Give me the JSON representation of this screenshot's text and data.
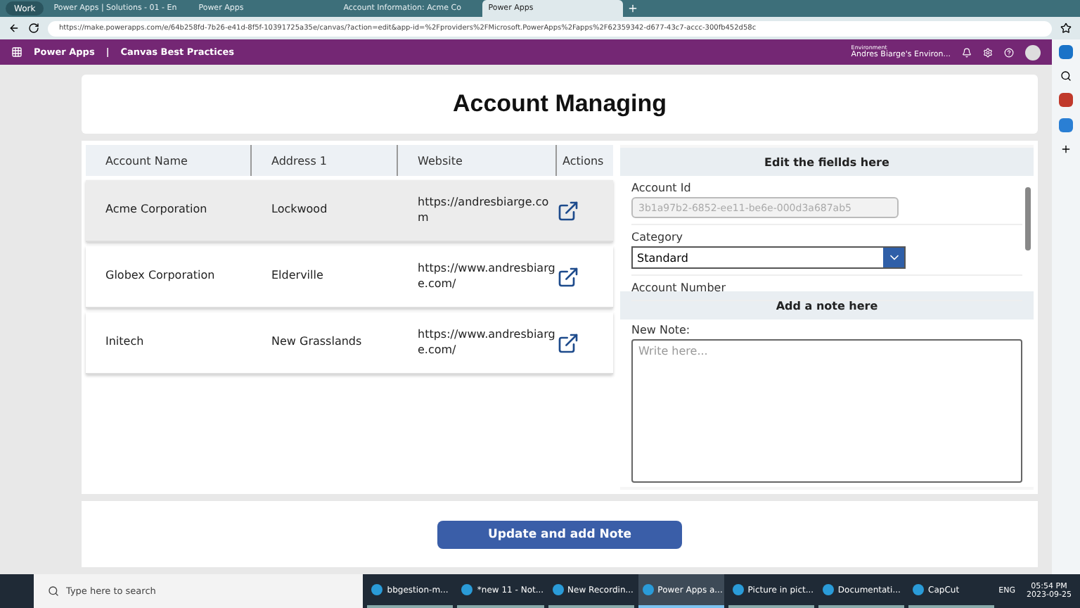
{
  "browser": {
    "profile": "Work",
    "tabs": [
      {
        "label": "Power Apps | Solutions - 01 - En",
        "selected": false
      },
      {
        "label": "Power Apps",
        "selected": false
      },
      {
        "label": "Account Information: Acme Co",
        "selected": false
      },
      {
        "label": "Power Apps",
        "selected": true
      }
    ],
    "url": "https://make.powerapps.com/e/64b258fd-7b26-e41d-8f5f-10391725a35e/canvas/?action=edit&app-id=%2Fproviders%2FMicrosoft.PowerApps%2Fapps%2F62359342-d677-43c7-accc-300fb452d58c"
  },
  "app_bar": {
    "product": "Power Apps",
    "separator": "|",
    "app_name": "Canvas Best Practices",
    "environment_label": "Environment",
    "environment": "Andres Biarge's Environ..."
  },
  "title": "Account Managing",
  "table": {
    "columns": [
      "Account Name",
      "Address 1",
      "Website",
      "Actions"
    ],
    "rows": [
      {
        "name": "Acme Corporation",
        "address": "Lockwood",
        "website": "https://andresbiarge.com",
        "selected": true
      },
      {
        "name": "Globex Corporation",
        "address": "Elderville",
        "website": "https://www.andresbiarge.com/",
        "selected": false
      },
      {
        "name": "Initech",
        "address": "New Grasslands",
        "website": "https://www.andresbiarge.com/",
        "selected": false
      }
    ]
  },
  "edit_panel": {
    "heading": "Edit the fiellds here",
    "fields": [
      {
        "kind": "text",
        "label": "Account Id",
        "value": "3b1a97b2-6852-ee11-be6e-000d3a687ab5",
        "disabled": true
      },
      {
        "kind": "dropdown",
        "label": "Category",
        "value": "Standard"
      },
      {
        "kind": "label",
        "label": "Account Number"
      }
    ]
  },
  "note_panel": {
    "heading": "Add a note here",
    "label": "New Note:",
    "placeholder": "Write here..."
  },
  "submit_button": "Update and add Note",
  "taskbar": {
    "search_placeholder": "Type here to search",
    "apps": [
      {
        "label": "bbgestion-m...",
        "selected": false
      },
      {
        "label": "*new 11 - Not...",
        "selected": false
      },
      {
        "label": "New Recordin...",
        "selected": false
      },
      {
        "label": "Power Apps a...",
        "selected": true
      },
      {
        "label": "Picture in pict...",
        "selected": false
      },
      {
        "label": "Documentati...",
        "selected": false
      },
      {
        "label": "CapCut",
        "selected": false
      }
    ],
    "language": "ENG",
    "time": "05:54 PM",
    "date": "2023-09-25"
  }
}
